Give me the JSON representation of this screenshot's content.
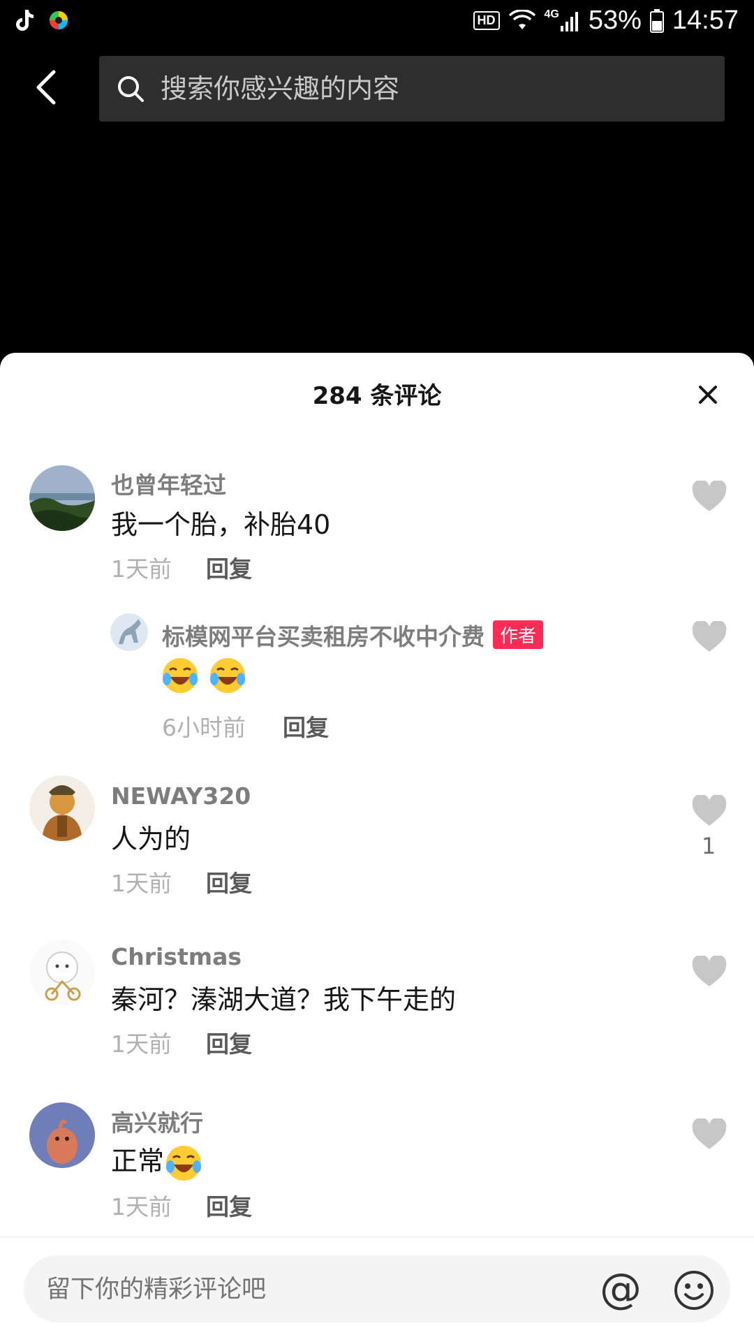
{
  "status_bar": {
    "hd": "HD",
    "network": "4G",
    "battery": "53%",
    "time": "14:57"
  },
  "search": {
    "placeholder": "搜索你感兴趣的内容"
  },
  "comments_panel": {
    "title": "284 条评论",
    "comments": [
      {
        "user": "也曾年轻过",
        "text": "我一个胎，补胎40",
        "time": "1天前",
        "reply_label": "回复",
        "likes": ""
      },
      {
        "user": "标模网平台买卖租房不收中介费",
        "author_tag": "作者",
        "time": "6小时前",
        "reply_label": "回复",
        "likes": ""
      },
      {
        "user": "NEWAY320",
        "text": "人为的",
        "time": "1天前",
        "reply_label": "回复",
        "likes": "1"
      },
      {
        "user": "Christmas",
        "text": "秦河？溱湖大道？我下午走的",
        "time": "1天前",
        "reply_label": "回复",
        "likes": ""
      },
      {
        "user": "高兴就行",
        "text": "正常",
        "time": "1天前",
        "reply_label": "回复",
        "likes": ""
      }
    ]
  },
  "composer": {
    "placeholder": "留下你的精彩评论吧",
    "at_symbol": "@"
  },
  "colors": {
    "accent": "#fe2c55",
    "sheet_bg": "#ffffff",
    "header_bg": "#000000"
  }
}
